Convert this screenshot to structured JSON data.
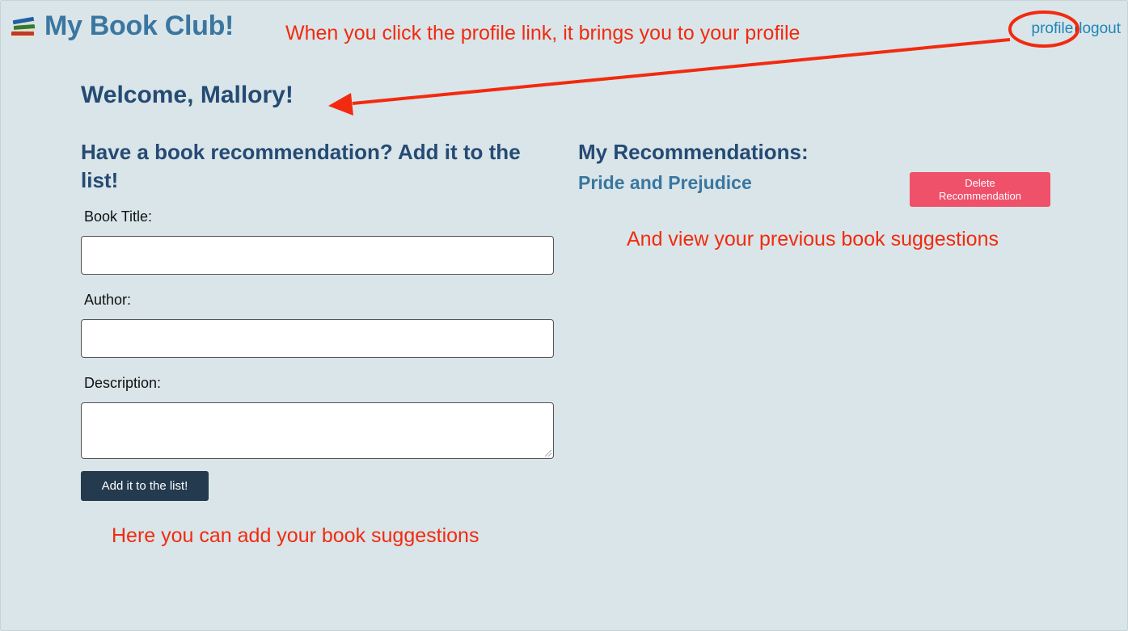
{
  "header": {
    "app_title": "My Book Club!",
    "brand_icon": "books-icon",
    "links": {
      "profile": "profile",
      "separator": "|",
      "logout": "logout"
    }
  },
  "welcome": "Welcome, Mallory!",
  "form": {
    "heading_line1": "Have a book recommendation? Add it to the",
    "heading_line2": "list!",
    "fields": {
      "title_label": "Book Title:",
      "title_value": "",
      "author_label": "Author:",
      "author_value": "",
      "description_label": "Description:",
      "description_value": ""
    },
    "submit_label": "Add it to the list!"
  },
  "recommendations": {
    "heading": "My Recommendations:",
    "items": [
      {
        "title": "Pride and Prejudice",
        "delete_line1": "Delete",
        "delete_line2": "Recommendation"
      }
    ]
  },
  "annotations": {
    "profile_note": "When you click the profile link, it brings you to your profile",
    "view_note": "And view your previous book suggestions",
    "add_note": "Here you can add your book suggestions",
    "color": "#f22a10"
  },
  "colors": {
    "background": "#d9e5e8",
    "brand": "#3a76a0",
    "heading": "#254a74",
    "link": "#1f86b8",
    "button_dark": "#243a4e",
    "button_delete": "#ef506a"
  }
}
